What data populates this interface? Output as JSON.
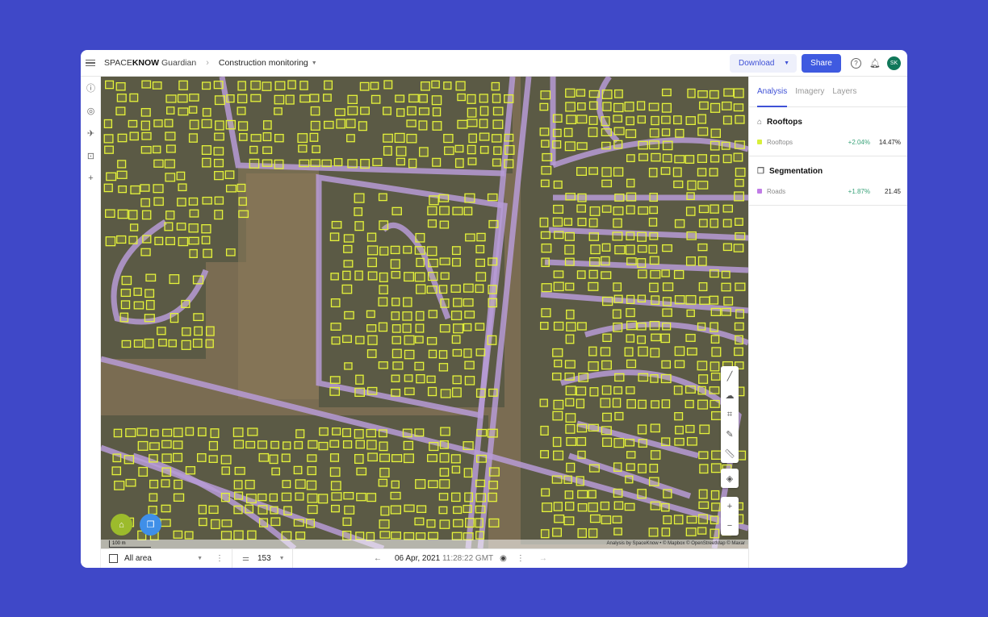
{
  "header": {
    "brand_light": "SPACE",
    "brand_bold": "KNOW",
    "brand_product": "Guardian",
    "project": "Construction monitoring",
    "download_label": "Download",
    "share_label": "Share",
    "avatar_initials": "SK"
  },
  "rail": {
    "icons": [
      "info-icon",
      "target-icon",
      "satellite-icon",
      "focus-icon",
      "plus-icon"
    ]
  },
  "map": {
    "attribution": "Analysis by SpaceKnow • © Mapbox © OpenStreetMap © Maxar",
    "scale_label": "100 m",
    "colors": {
      "roads": "#b79bd6",
      "rooftops": "#e4f23a"
    }
  },
  "bottom": {
    "area_label": "All area",
    "filter_value": "153",
    "date": "06 Apr, 2021",
    "time": "11:28:22 GMT"
  },
  "panel": {
    "tabs": [
      {
        "label": "Analysis",
        "active": true
      },
      {
        "label": "Imagery"
      },
      {
        "label": "Layers"
      }
    ],
    "sections": [
      {
        "title": "Rooftops",
        "icon": "home-icon",
        "rows": [
          {
            "label": "Rooftops",
            "change": "+2.04%",
            "value": "14.47%",
            "color": "#d8ef3a"
          }
        ]
      },
      {
        "title": "Segmentation",
        "icon": "segmentation-icon",
        "rows": [
          {
            "label": "Roads",
            "change": "+1.87%",
            "value": "21.45",
            "color": "#c07ce6"
          }
        ]
      }
    ]
  }
}
